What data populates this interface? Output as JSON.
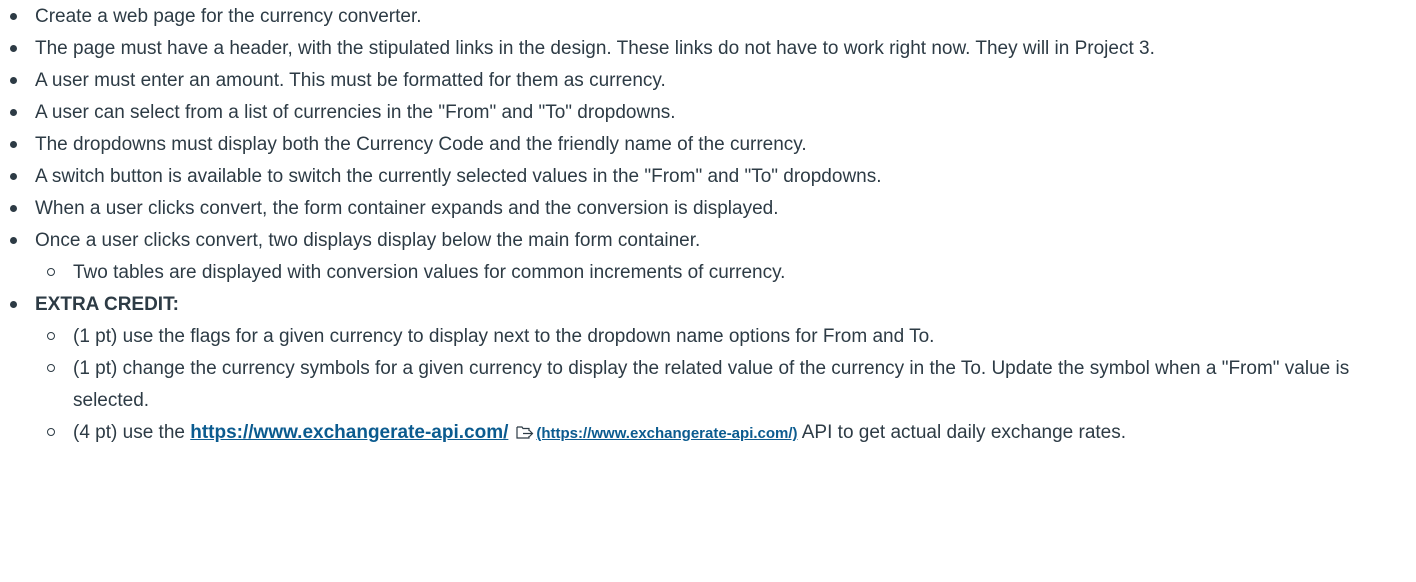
{
  "items": [
    {
      "text": "Create a web page for the currency converter."
    },
    {
      "text": "The page must have a header, with the stipulated links in the design. These links do not have to work right now. They will in Project 3."
    },
    {
      "text": "A user must enter an amount. This must be formatted for them as currency."
    },
    {
      "text": "A user can select from a list of currencies in the \"From\" and \"To\" dropdowns."
    },
    {
      "text": "The dropdowns must display both the Currency Code and the friendly name of the currency."
    },
    {
      "text": "A switch button is available to switch the currently selected values in the \"From\" and \"To\" dropdowns."
    },
    {
      "text": "When a user clicks convert, the form container expands and the conversion is displayed."
    },
    {
      "text": "Once a user clicks convert, two displays display below the main form container."
    }
  ],
  "sub_tables": "Two tables are displayed with conversion values for common increments of currency.",
  "extra_credit": {
    "heading": "EXTRA CREDIT:",
    "item1": "(1 pt) use the flags for a given currency to display next to the dropdown name options for From and To.",
    "item2": "(1 pt) change the currency symbols for a given currency to display the related value of the currency in the To. Update the symbol when a \"From\" value is selected.",
    "item3_prefix": "(4 pt) use the ",
    "item3_link": "https://www.exchangerate-api.com/",
    "item3_link_paren": "(https://www.exchangerate-api.com/)",
    "item3_suffix": " API to get actual daily exchange rates."
  },
  "icons": {
    "external": "external-link-icon"
  }
}
